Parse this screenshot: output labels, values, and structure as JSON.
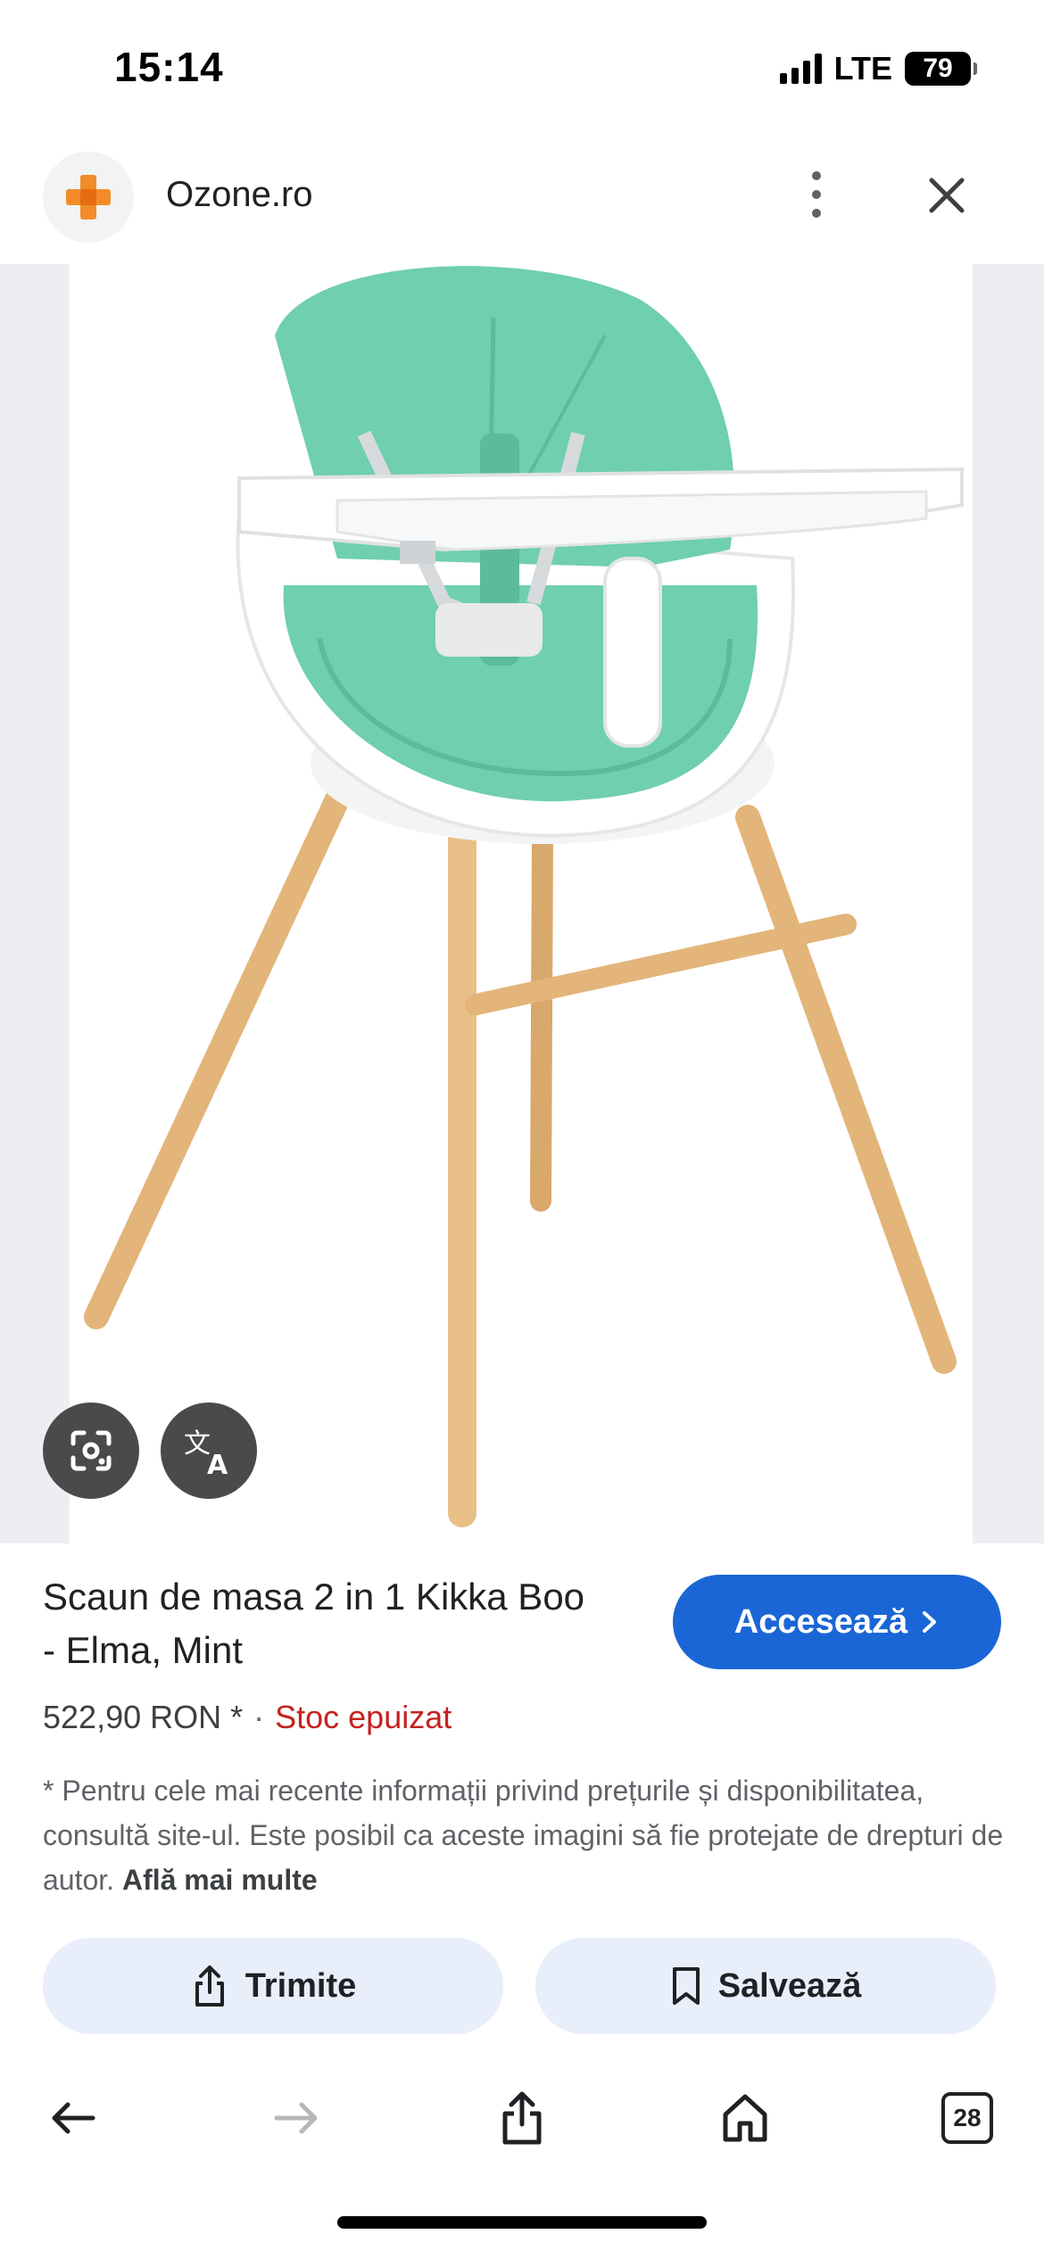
{
  "status_bar": {
    "time": "15:14",
    "network": "LTE",
    "battery": "79"
  },
  "site": {
    "name": "Ozone.ro",
    "logo_color": "#f28c28"
  },
  "product": {
    "title": "Scaun de masa 2 in 1 Kikka Boo - Elma, Mint",
    "price": "522,90 RON *",
    "separator": "·",
    "stock": "Stoc epuizat",
    "stock_color": "#c5221f",
    "disclaimer": "* Pentru cele mai recente informații privind prețurile și disponibilitatea, consultă site-ul. Este posibil ca aceste imagini să fie protejate de drepturi de autor.",
    "learn_more": "Află mai multe",
    "seat_color": "#6fcfae"
  },
  "buttons": {
    "access": "Accesează",
    "send": "Trimite",
    "save": "Salvează",
    "access_color": "#1a66d6"
  },
  "nav": {
    "tabs_count": "28"
  },
  "icons": {
    "lens": "lens-icon",
    "translate": "translate-icon",
    "back": "arrow-left-icon",
    "forward": "arrow-right-icon",
    "share": "share-icon",
    "home": "home-icon",
    "bookmark": "bookmark-icon",
    "more": "more-vert-icon",
    "close": "close-icon"
  }
}
